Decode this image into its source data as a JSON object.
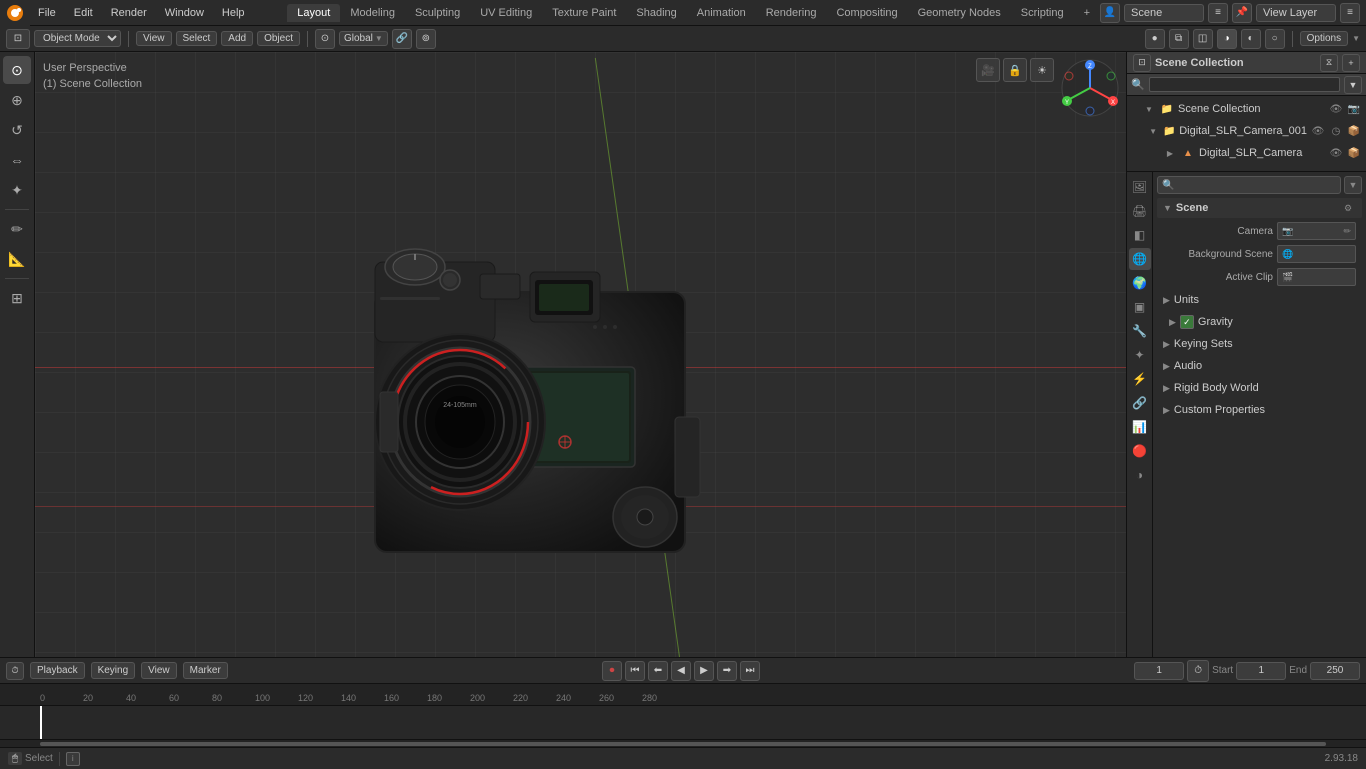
{
  "topbar": {
    "menu_items": [
      "File",
      "Edit",
      "Render",
      "Window",
      "Help"
    ],
    "workspace_tabs": [
      "Layout",
      "Modeling",
      "Sculpting",
      "UV Editing",
      "Texture Paint",
      "Shading",
      "Animation",
      "Rendering",
      "Compositing",
      "Geometry Nodes",
      "Scripting"
    ],
    "active_tab": "Layout",
    "add_tab_label": "+",
    "scene_name": "Scene",
    "view_layer": "View Layer"
  },
  "viewport_header": {
    "mode_label": "Object Mode",
    "view_label": "View",
    "select_label": "Select",
    "add_label": "Add",
    "object_label": "Object",
    "transform_global": "Global",
    "options_label": "Options"
  },
  "viewport_info": {
    "line1": "User Perspective",
    "line2": "(1) Scene Collection"
  },
  "outliner": {
    "title": "Scene Collection",
    "search_placeholder": "🔍",
    "items": [
      {
        "indent": 0,
        "label": "Scene Collection",
        "icon": "📁",
        "expanded": true,
        "actions": [
          "👁",
          "✓"
        ]
      },
      {
        "indent": 1,
        "label": "Digital_SLR_Camera_001",
        "icon": "📷",
        "expanded": true,
        "actions": [
          "👁",
          "📦"
        ]
      },
      {
        "indent": 2,
        "label": "Digital_SLR_Camera",
        "icon": "▲",
        "expanded": false,
        "actions": [
          "👁",
          "📦"
        ]
      }
    ]
  },
  "properties": {
    "active_tab": "scene",
    "tabs": [
      "render",
      "output",
      "view_layer",
      "scene",
      "world",
      "object",
      "modifier",
      "particles",
      "physics",
      "constraints",
      "object_data",
      "material",
      "shading"
    ],
    "scene_section": {
      "title": "Scene",
      "camera_label": "Camera",
      "camera_value": "",
      "background_scene_label": "Background Scene",
      "background_scene_value": "",
      "active_clip_label": "Active Clip",
      "active_clip_value": ""
    },
    "units_label": "Units",
    "gravity_label": "Gravity",
    "gravity_checked": true,
    "keying_sets_label": "Keying Sets",
    "audio_label": "Audio",
    "rigid_body_world_label": "Rigid Body World",
    "custom_properties_label": "Custom Properties"
  },
  "timeline": {
    "playback_label": "Playback",
    "keying_label": "Keying",
    "view_label": "View",
    "marker_label": "Marker",
    "frame_current": "1",
    "frame_start_label": "Start",
    "frame_start": "1",
    "frame_end_label": "End",
    "frame_end": "250",
    "ruler_marks": [
      "0",
      "20",
      "40",
      "60",
      "80",
      "100",
      "120",
      "140",
      "160",
      "180",
      "200",
      "220",
      "240",
      "260",
      "280"
    ]
  },
  "statusbar": {
    "select_label": "Select",
    "version": "2.93.18"
  },
  "icons": {
    "arrow_right": "▶",
    "arrow_down": "▼",
    "check": "✓",
    "camera": "🎥",
    "scene": "🌐",
    "x": "✕",
    "plus": "+",
    "eye": "👁",
    "filter": "⧖",
    "move": "⊕",
    "rotate": "↺",
    "scale": "⇔",
    "transform": "✦",
    "cursor": "⊙",
    "select_box": "⬜",
    "annotate": "✏",
    "measure": "📐",
    "add_obj": "⊞"
  }
}
